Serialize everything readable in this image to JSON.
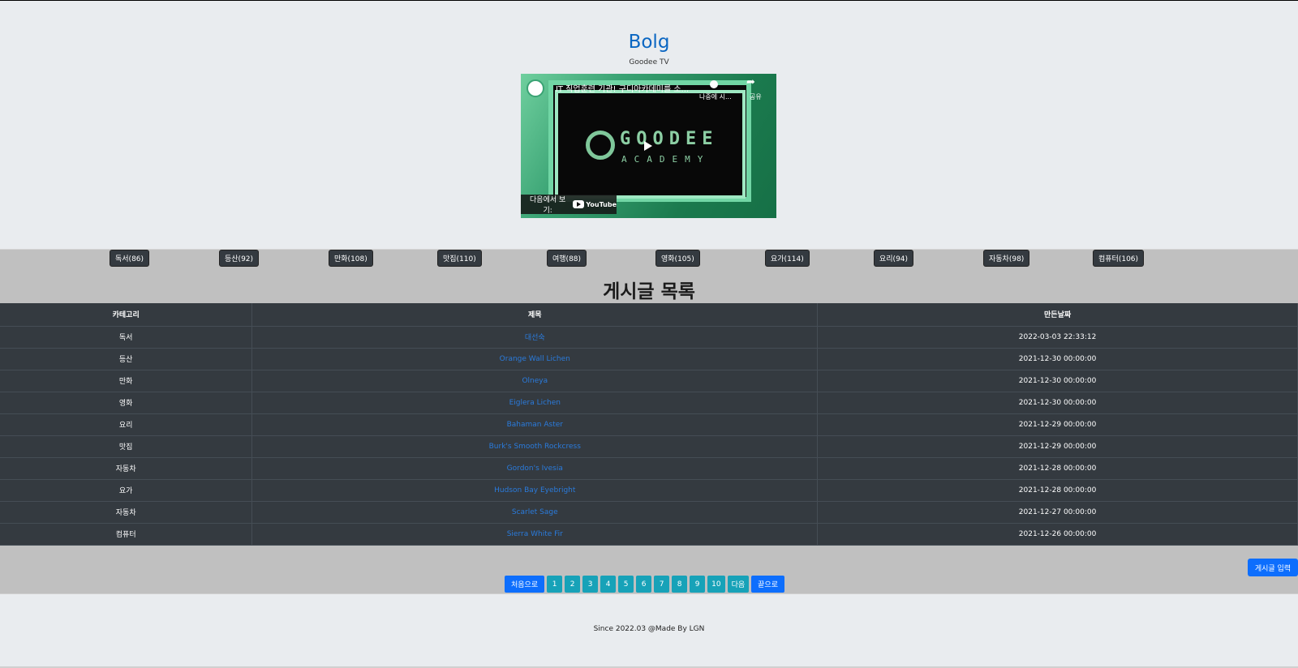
{
  "header": {
    "title": "Bolg",
    "subtitle": "Goodee TV"
  },
  "video": {
    "title": "IT 직업훈련 기관! 구디아카데미를 소...",
    "watch_later": "나중에 시...",
    "share": "공유",
    "watch_on": "다음에서 보기:",
    "youtube": "YouTube",
    "brand_line1": "GOODEE",
    "brand_line2": "ACADEMY"
  },
  "categories": [
    {
      "label": "독서(86)"
    },
    {
      "label": "등산(92)"
    },
    {
      "label": "만화(108)"
    },
    {
      "label": "맛집(110)"
    },
    {
      "label": "여행(88)"
    },
    {
      "label": "영화(105)"
    },
    {
      "label": "요가(114)"
    },
    {
      "label": "요리(94)"
    },
    {
      "label": "자동차(98)"
    },
    {
      "label": "컴퓨터(106)"
    }
  ],
  "list_title": "게시글 목록",
  "table": {
    "headers": [
      "카테고리",
      "제목",
      "만든날짜"
    ],
    "rows": [
      [
        "독서",
        "대선숙",
        "2022-03-03 22:33:12"
      ],
      [
        "등산",
        "Orange Wall Lichen",
        "2021-12-30 00:00:00"
      ],
      [
        "만화",
        "Olneya",
        "2021-12-30 00:00:00"
      ],
      [
        "영화",
        "Eiglera Lichen",
        "2021-12-30 00:00:00"
      ],
      [
        "요리",
        "Bahaman Aster",
        "2021-12-29 00:00:00"
      ],
      [
        "맛집",
        "Burk's Smooth Rockcress",
        "2021-12-29 00:00:00"
      ],
      [
        "자동차",
        "Gordon's Ivesia",
        "2021-12-28 00:00:00"
      ],
      [
        "요가",
        "Hudson Bay Eyebright",
        "2021-12-28 00:00:00"
      ],
      [
        "자동차",
        "Scarlet Sage",
        "2021-12-27 00:00:00"
      ],
      [
        "컴퓨터",
        "Sierra White Fir",
        "2021-12-26 00:00:00"
      ]
    ]
  },
  "write_button": "게시글 입력",
  "pagination": {
    "first": "처음으로",
    "pages": [
      "1",
      "2",
      "3",
      "4",
      "5",
      "6",
      "7",
      "8",
      "9",
      "10"
    ],
    "next": "다음",
    "last": "끝으로"
  },
  "footer": {
    "text": "Since 2022.03 @Made By LGN"
  },
  "colors": {
    "accent": "#0d6efd",
    "teal": "#17a2b8",
    "dark": "#343a40",
    "link": "#2a7bdc"
  }
}
